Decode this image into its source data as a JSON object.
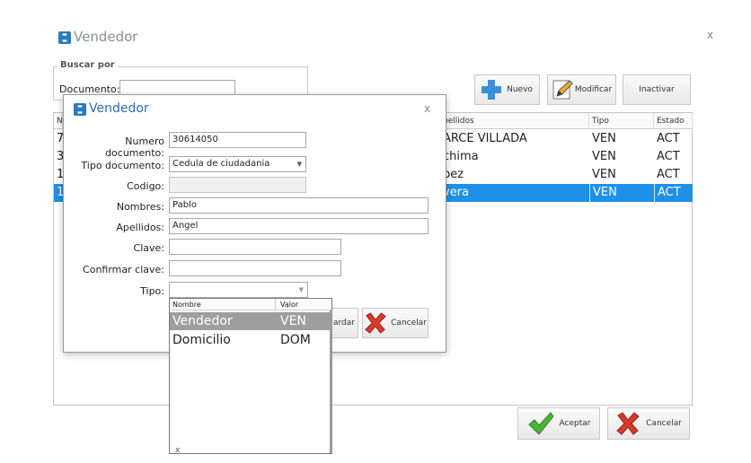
{
  "main_window": {
    "title": "Vendedor",
    "close": "x",
    "search_group_label": "Buscar por",
    "document_label": "Documento:",
    "document_value": "",
    "buttons": {
      "new": "Nuevo",
      "modify": "Modificar",
      "deactivate": "Inactivar",
      "accept": "Aceptar",
      "cancel": "Cancelar"
    },
    "table": {
      "headers": [
        "N",
        "pellidos",
        "Tipo",
        "Estado"
      ],
      "rows": [
        {
          "n": "7",
          "apellidos": "ARCE VILLADA",
          "tipo": "VEN",
          "estado": "ACT"
        },
        {
          "n": "3",
          "apellidos": "chima",
          "tipo": "VEN",
          "estado": "ACT"
        },
        {
          "n": "1",
          "apellidos": "pez",
          "tipo": "VEN",
          "estado": "ACT"
        },
        {
          "n": "1",
          "apellidos": "vera",
          "tipo": "VEN",
          "estado": "ACT"
        }
      ]
    }
  },
  "dialog": {
    "title": "Vendedor",
    "close": "x",
    "fields": {
      "numero_label": "Numero documento:",
      "numero_value": "30614050",
      "tipo_doc_label": "Tipo documento:",
      "tipo_doc_value": "Cedula de ciudadania",
      "codigo_label": "Codigo:",
      "codigo_value": "",
      "nombres_label": "Nombres:",
      "nombres_value": "Pablo",
      "apellidos_label": "Apellidos:",
      "apellidos_value": "Angel",
      "clave_label": "Clave:",
      "clave_value": "",
      "confirmar_label": "Confirmar clave:",
      "confirmar_value": "",
      "tipo_label": "Tipo:",
      "tipo_value": ""
    },
    "buttons": {
      "save_partial": "ardar",
      "cancel": "Cancelar"
    }
  },
  "dropdown": {
    "headers": [
      "Nombre",
      "Valor"
    ],
    "options": [
      {
        "nombre": "Vendedor",
        "valor": "VEN"
      },
      {
        "nombre": "Domicilio",
        "valor": "DOM"
      }
    ],
    "footer_symbol": "x"
  },
  "colors": {
    "selection": "#1e90e8",
    "dropdown_highlight": "#9e9e9e",
    "title_blue": "#2a6fb0"
  }
}
